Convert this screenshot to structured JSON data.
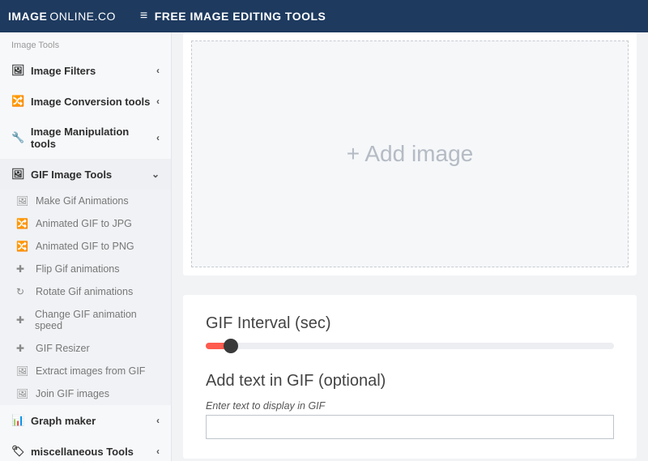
{
  "header": {
    "logo_strong": "IMAGE",
    "logo_thin": "ONLINE.CO",
    "menu_label": "FREE IMAGE EDITING TOOLS"
  },
  "sidebar": {
    "heading": "Image Tools",
    "items": [
      {
        "icon": "🖼",
        "label": "Image Filters"
      },
      {
        "icon": "🔀",
        "label": "Image Conversion tools"
      },
      {
        "icon": "🔧",
        "label": "Image Manipulation tools"
      }
    ],
    "gif_item": {
      "icon": "🖼",
      "label": "GIF Image Tools"
    },
    "gif_subitems": [
      {
        "icon": "🖼",
        "label": "Make Gif Animations"
      },
      {
        "icon": "🔀",
        "label": "Animated GIF to JPG"
      },
      {
        "icon": "🔀",
        "label": "Animated GIF to PNG"
      },
      {
        "icon": "✚",
        "label": "Flip Gif animations"
      },
      {
        "icon": "↻",
        "label": "Rotate Gif animations"
      },
      {
        "icon": "✚",
        "label": "Change GIF animation speed"
      },
      {
        "icon": "✚",
        "label": "GIF Resizer"
      },
      {
        "icon": "🖼",
        "label": "Extract images from GIF"
      },
      {
        "icon": "🖼",
        "label": "Join GIF images"
      }
    ],
    "bottom_items": [
      {
        "icon": "📊",
        "label": "Graph maker"
      },
      {
        "icon": "🏷",
        "label": "miscellaneous Tools"
      }
    ]
  },
  "main": {
    "add_image": "+ Add image",
    "interval_title": "GIF Interval (sec)",
    "addtext_title": "Add text in GIF (optional)",
    "addtext_hint": "Enter text to display in GIF",
    "text_value": ""
  }
}
